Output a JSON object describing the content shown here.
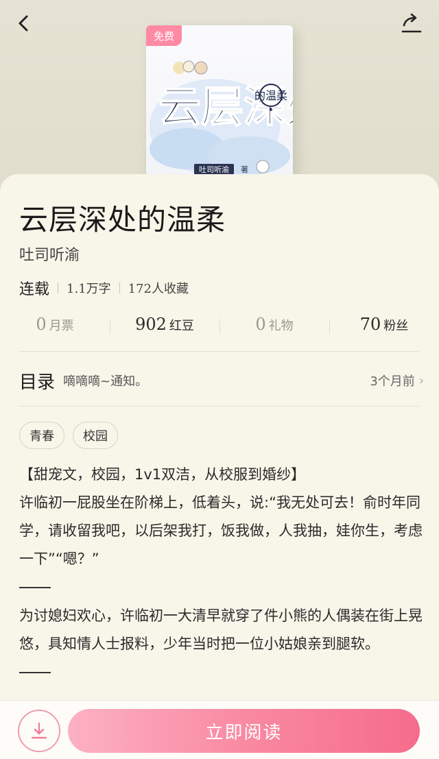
{
  "book": {
    "title": "云层深处的温柔",
    "author": "吐司听渝",
    "status": "连载",
    "word_count": "1.1万字",
    "favorites": "172人收藏",
    "cover": {
      "badge": "免费",
      "title_art": "云层深处",
      "subtitle_art": "的温柔",
      "author_art": "吐司听渝",
      "author_mark": "著"
    }
  },
  "stats": [
    {
      "value": "0",
      "label": "月票"
    },
    {
      "value": "902",
      "label": "红豆"
    },
    {
      "value": "0",
      "label": "礼物"
    },
    {
      "value": "70",
      "label": "粉丝"
    }
  ],
  "toc": {
    "title": "目录",
    "latest_chapter": "嘀嘀嘀~通知。",
    "updated": "3个月前"
  },
  "tags": [
    "青春",
    "校园"
  ],
  "description": {
    "line1": "【甜宠文，校园，1v1双洁，从校服到婚纱】",
    "para1": "许临初一屁股坐在阶梯上，低着头，说:“我无处可去！俞时年同学，请收留我吧，以后架我打，饭我做，人我抽，娃你生，考虑一下”“嗯？”",
    "para2": "为讨媳妇欢心，许临初一大清早就穿了件小熊的人偶装在街上晃悠，具知情人士报料，少年当时把一位小姑娘亲到腿软。"
  },
  "actions": {
    "read_label": "立即阅读",
    "download_icon": "download-icon",
    "back_icon": "chevron-left-icon",
    "share_icon": "share-icon"
  },
  "colors": {
    "accent": "#f9869f",
    "sheet_bg": "#f8f5e9",
    "header_bg": "#e4e1d2"
  }
}
